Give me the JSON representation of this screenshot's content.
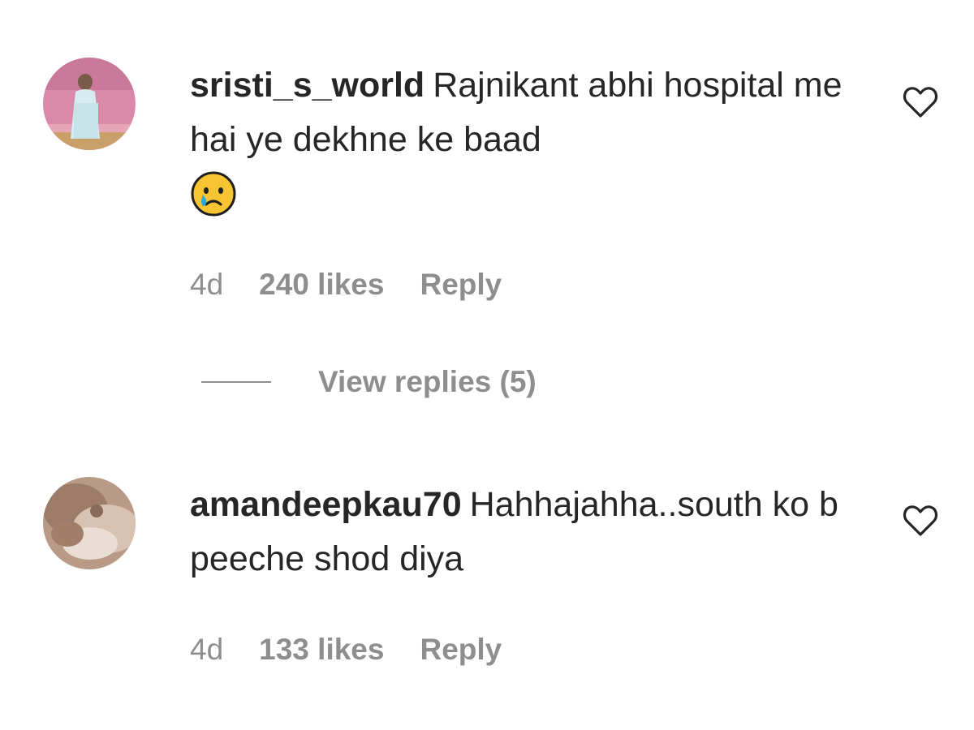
{
  "comments": [
    {
      "username": "sristi_s_world",
      "text": "Rajnikant abhi hospital me hai ye dekhne ke baad",
      "emoji": "crying-face",
      "time": "4d",
      "likes": "240 likes",
      "reply_label": "Reply",
      "view_replies": "View replies (5)"
    },
    {
      "username": "amandeepkau70",
      "text": "Hahhajahha..south ko b peeche shod diya",
      "time": "4d",
      "likes": "133 likes",
      "reply_label": "Reply"
    }
  ],
  "icons": {
    "like": "heart-outline-icon"
  },
  "colors": {
    "text": "#262626",
    "secondary_text": "#8e8e8e"
  }
}
